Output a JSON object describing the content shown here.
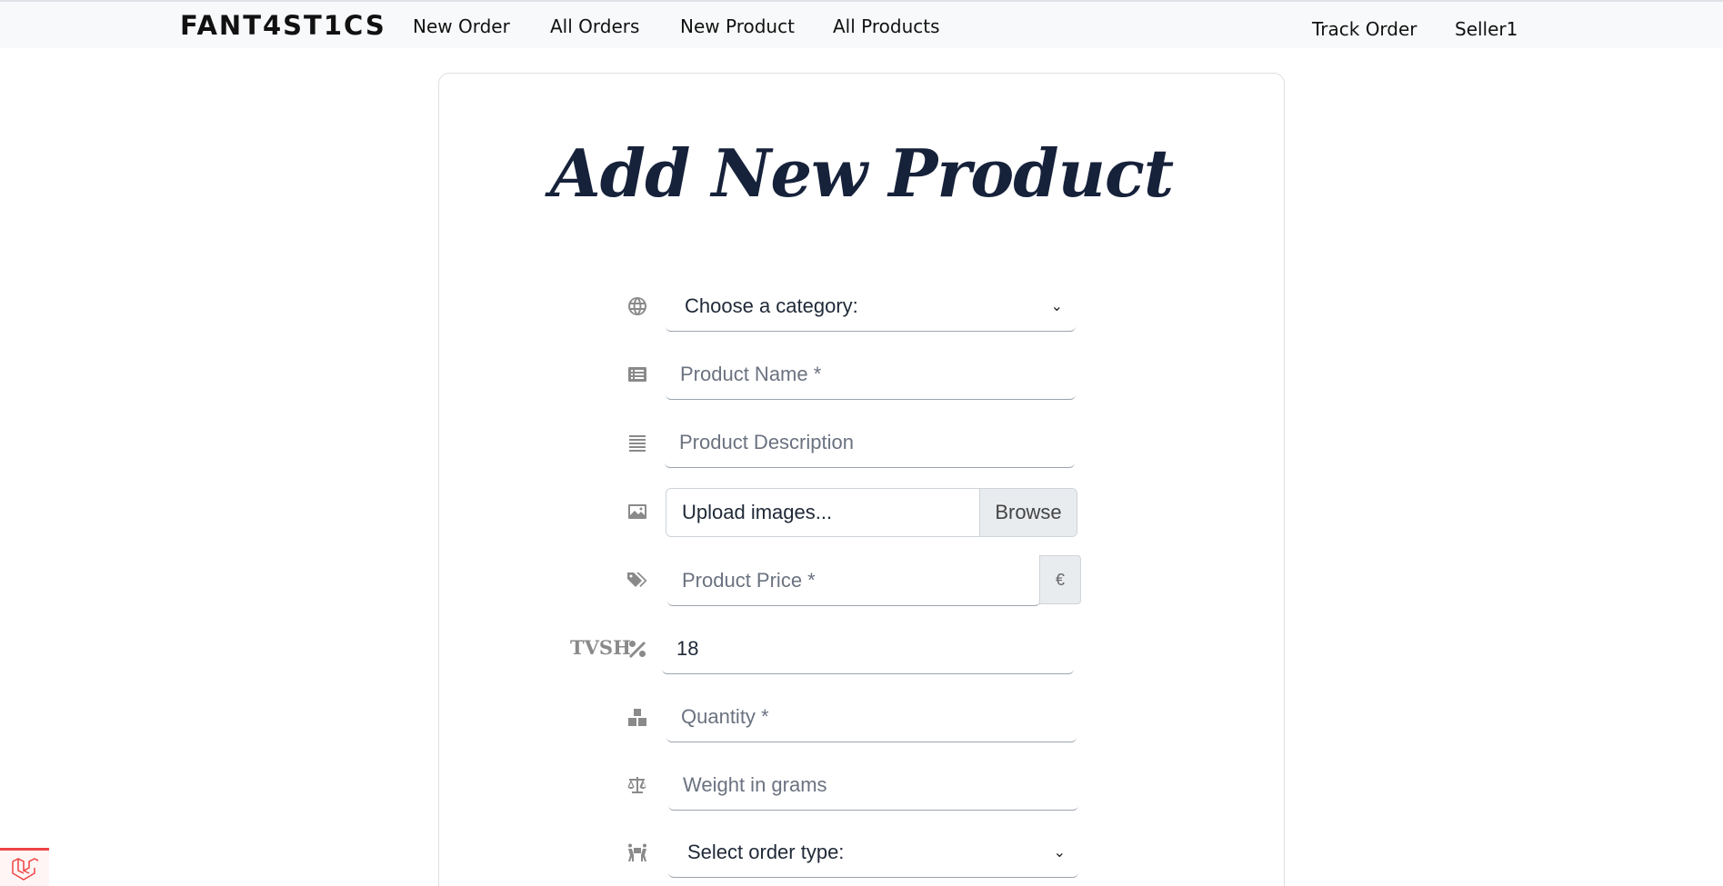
{
  "nav": {
    "brand": "FANT4ST1CS",
    "links": [
      "New Order",
      "All Orders",
      "New Product",
      "All Products"
    ],
    "right_links": [
      "Track Order",
      "Seller1"
    ]
  },
  "form": {
    "title": "Add New Product",
    "category": {
      "value": "Choose a category:"
    },
    "product_name": {
      "placeholder": "Product Name *"
    },
    "product_description": {
      "placeholder": "Product Description"
    },
    "upload": {
      "label": "Upload images...",
      "button": "Browse"
    },
    "product_price": {
      "placeholder": "Product Price *",
      "currency": "€"
    },
    "tvsh": {
      "label": "TVSH",
      "value": "18"
    },
    "quantity": {
      "placeholder": "Quantity *"
    },
    "weight": {
      "placeholder": "Weight in grams"
    },
    "order_type": {
      "value": "Select order type:"
    }
  },
  "icons": {
    "category": "globe-icon",
    "product_name": "list-alt-icon",
    "description": "align-justify-icon",
    "upload": "image-icon",
    "price": "tags-icon",
    "tvsh": "percent-icon",
    "quantity": "boxes-icon",
    "weight": "balance-scale-icon",
    "order_type": "people-carry-icon",
    "debug": "laravel-icon"
  }
}
